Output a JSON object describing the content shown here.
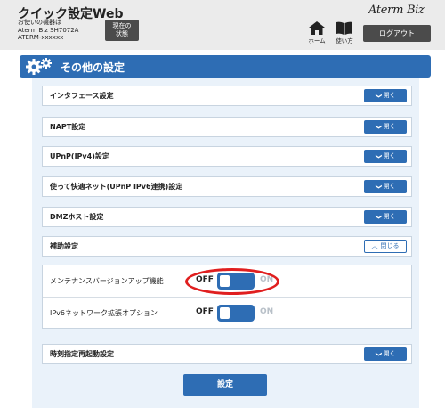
{
  "header": {
    "title": "クイック設定Web",
    "device_info_line1": "お使いの機器は",
    "device_info_line2": "Aterm Biz SH7072A",
    "device_info_line3": "ATERM-xxxxxx",
    "status_button_line1": "現在の",
    "status_button_line2": "状態",
    "brand": "Aterm Biz",
    "home_label": "ホーム",
    "howto_label": "使い方",
    "logout_label": "ログアウト"
  },
  "section": {
    "title": "その他の設定"
  },
  "rows": [
    {
      "label": "インタフェース設定",
      "button": "開く"
    },
    {
      "label": "NAPT設定",
      "button": "開く"
    },
    {
      "label": "UPnP(IPv4)設定",
      "button": "開く"
    },
    {
      "label": "使って快適ネット(UPnP IPv6連携)設定",
      "button": "開く"
    },
    {
      "label": "DMZホスト設定",
      "button": "開く"
    },
    {
      "label": "補助設定",
      "button": "閉じる"
    }
  ],
  "sub_settings": [
    {
      "label": "メンテナンスバージョンアップ機能",
      "off": "OFF",
      "on": "ON",
      "state": "OFF"
    },
    {
      "label": "IPv6ネットワーク拡張オプション",
      "off": "OFF",
      "on": "ON",
      "state": "OFF"
    }
  ],
  "bottom_row": {
    "label": "時刻指定再起動設定",
    "button": "開く"
  },
  "submit_label": "設定",
  "colors": {
    "accent": "#2e6db4",
    "highlight_ring": "#e01f1f"
  }
}
